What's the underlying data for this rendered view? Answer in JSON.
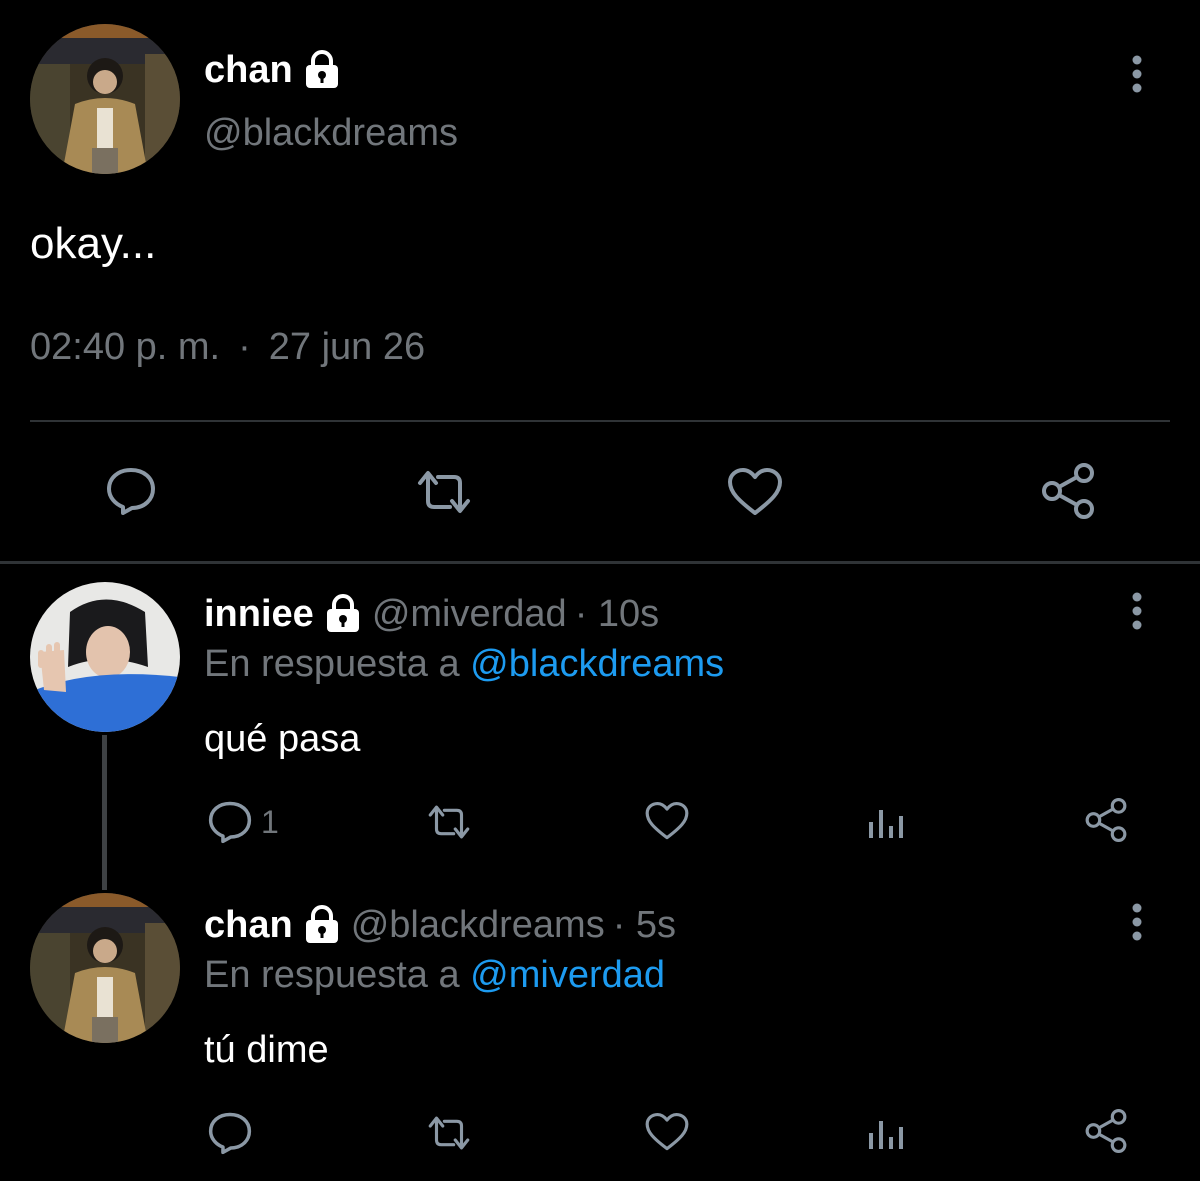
{
  "main_tweet": {
    "author_name": "chan",
    "author_handle": "@blackdreams",
    "text": "okay...",
    "time": "02:40 p. m.",
    "separator": "·",
    "date": "27 jun 26"
  },
  "replies": [
    {
      "author_name": "inniee",
      "author_handle": "@miverdad",
      "age": "· 10s",
      "reply_prefix": "En respuesta a",
      "reply_to": "@blackdreams",
      "text": "qué pasa",
      "reply_count": "1"
    },
    {
      "author_name": "chan",
      "author_handle": "@blackdreams",
      "age": "· 5s",
      "reply_prefix": "En respuesta a",
      "reply_to": "@miverdad",
      "text": "tú dime",
      "reply_count": ""
    }
  ],
  "icons": {
    "more": "more-vertical-icon",
    "lock": "lock-icon",
    "reply": "reply-icon",
    "retweet": "retweet-icon",
    "like": "heart-icon",
    "analytics": "analytics-icon",
    "share": "share-icon"
  },
  "colors": {
    "background": "#000000",
    "text": "#ffffff",
    "muted": "#71767b",
    "accent": "#1d9bf0",
    "divider": "#2f3336"
  }
}
